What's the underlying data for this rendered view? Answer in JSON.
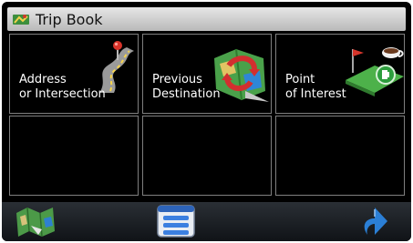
{
  "title": "Trip Book",
  "tiles": [
    {
      "line1": "Address",
      "line2": "or Intersection",
      "icon": "address-icon"
    },
    {
      "line1": "Previous",
      "line2": "Destination",
      "icon": "previous-destination-icon"
    },
    {
      "line1": "Point",
      "line2": "of Interest",
      "icon": "poi-icon"
    }
  ],
  "bottom_icons": [
    "map-icon",
    "list-icon",
    "back-icon"
  ],
  "colors": {
    "title_bar": "#cfcfcf",
    "tile_border": "#7f7f7f",
    "background": "#000000",
    "accent_blue": "#2b7fd6"
  }
}
